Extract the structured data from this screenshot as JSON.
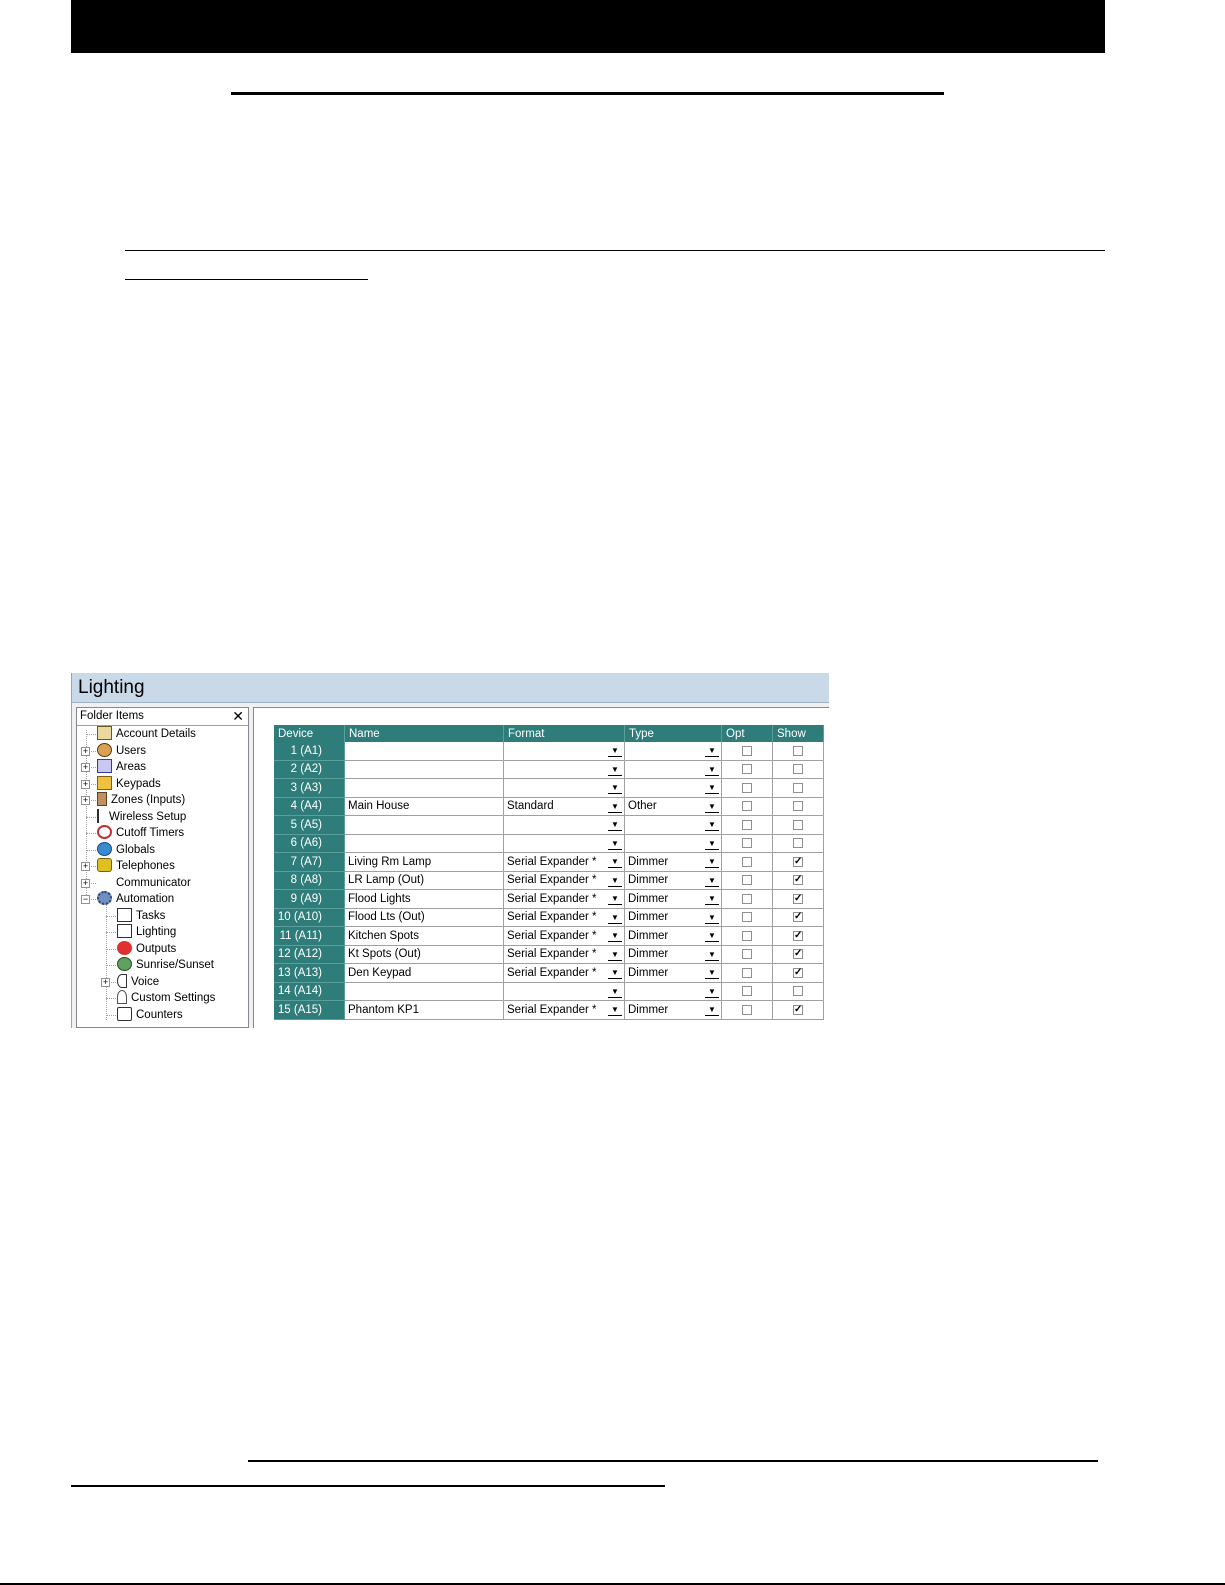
{
  "screenshot": {
    "window_title": "Lighting",
    "folder_pane": {
      "header": "Folder Items",
      "close_glyph": "✕",
      "items": [
        {
          "label": "Account Details",
          "icon": "account-details-icon",
          "expandable": false,
          "level": 0
        },
        {
          "label": "Users",
          "icon": "users-icon",
          "expandable": true,
          "level": 0
        },
        {
          "label": "Areas",
          "icon": "areas-icon",
          "expandable": true,
          "level": 0
        },
        {
          "label": "Keypads",
          "icon": "keypads-icon",
          "expandable": true,
          "level": 0
        },
        {
          "label": "Zones (Inputs)",
          "icon": "zones-icon",
          "expandable": true,
          "level": 0
        },
        {
          "label": "Wireless Setup",
          "icon": "wireless-icon",
          "expandable": false,
          "level": 0
        },
        {
          "label": "Cutoff Timers",
          "icon": "timer-icon",
          "expandable": false,
          "level": 0
        },
        {
          "label": "Globals",
          "icon": "globe-icon",
          "expandable": false,
          "level": 0
        },
        {
          "label": "Telephones",
          "icon": "telephone-icon",
          "expandable": true,
          "level": 0
        },
        {
          "label": "Communicator",
          "icon": "communicator-icon",
          "expandable": true,
          "level": 0
        },
        {
          "label": "Automation",
          "icon": "automation-gear-icon",
          "expandable": true,
          "expanded": true,
          "level": 0
        },
        {
          "label": "Tasks",
          "icon": "tasks-icon",
          "expandable": false,
          "level": 1
        },
        {
          "label": "Lighting",
          "icon": "lighting-icon",
          "expandable": false,
          "level": 1
        },
        {
          "label": "Outputs",
          "icon": "outputs-icon",
          "expandable": false,
          "level": 1
        },
        {
          "label": "Sunrise/Sunset",
          "icon": "sunrise-icon",
          "expandable": false,
          "level": 1
        },
        {
          "label": "Voice",
          "icon": "voice-icon",
          "expandable": true,
          "level": 1
        },
        {
          "label": "Custom Settings",
          "icon": "custom-settings-icon",
          "expandable": false,
          "level": 1
        },
        {
          "label": "Counters",
          "icon": "counters-icon",
          "expandable": false,
          "level": 1
        }
      ]
    },
    "grid": {
      "columns": [
        "Device",
        "Name",
        "Format",
        "Type",
        "Opt",
        "Show"
      ],
      "rows": [
        {
          "device": "1 (A1)",
          "name": "",
          "format": "",
          "type": "",
          "opt": false,
          "show": false
        },
        {
          "device": "2 (A2)",
          "name": "",
          "format": "",
          "type": "",
          "opt": false,
          "show": false
        },
        {
          "device": "3 (A3)",
          "name": "",
          "format": "",
          "type": "",
          "opt": false,
          "show": false
        },
        {
          "device": "4 (A4)",
          "name": "Main House",
          "format": "Standard",
          "type": "Other",
          "opt": false,
          "show": false
        },
        {
          "device": "5 (A5)",
          "name": "",
          "format": "",
          "type": "",
          "opt": false,
          "show": false
        },
        {
          "device": "6 (A6)",
          "name": "",
          "format": "",
          "type": "",
          "opt": false,
          "show": false
        },
        {
          "device": "7 (A7)",
          "name": "Living Rm Lamp",
          "format": "Serial Expander *",
          "type": "Dimmer",
          "opt": false,
          "show": true
        },
        {
          "device": "8 (A8)",
          "name": "LR Lamp (Out)",
          "format": "Serial Expander *",
          "type": "Dimmer",
          "opt": false,
          "show": true
        },
        {
          "device": "9 (A9)",
          "name": "Flood Lights",
          "format": "Serial Expander *",
          "type": "Dimmer",
          "opt": false,
          "show": true
        },
        {
          "device": "10 (A10)",
          "name": "Flood Lts (Out)",
          "format": "Serial Expander *",
          "type": "Dimmer",
          "opt": false,
          "show": true
        },
        {
          "device": "11 (A11)",
          "name": "Kitchen Spots",
          "format": "Serial Expander *",
          "type": "Dimmer",
          "opt": false,
          "show": true
        },
        {
          "device": "12 (A12)",
          "name": "Kt Spots (Out)",
          "format": "Serial Expander *",
          "type": "Dimmer",
          "opt": false,
          "show": true
        },
        {
          "device": "13 (A13)",
          "name": "Den Keypad",
          "format": "Serial Expander *",
          "type": "Dimmer",
          "opt": false,
          "show": true
        },
        {
          "device": "14 (A14)",
          "name": "",
          "format": "",
          "type": "",
          "opt": false,
          "show": false
        },
        {
          "device": "15 (A15)",
          "name": "Phantom KP1",
          "format": "Serial Expander *",
          "type": "Dimmer",
          "opt": false,
          "show": true
        }
      ]
    },
    "colors": {
      "header_bar": "#000000",
      "grid_header": "#2f7d7a",
      "title_bar": "#c9d9e8"
    }
  }
}
